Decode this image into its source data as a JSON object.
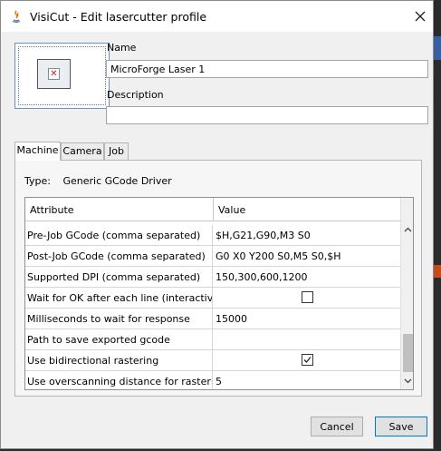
{
  "window": {
    "title": "VisiCut - Edit lasercutter profile",
    "close_icon": "close-icon",
    "app_icon": "java-icon"
  },
  "form": {
    "name_label": "Name",
    "name_value": "MicroForge Laser 1",
    "description_label": "Description",
    "description_value": ""
  },
  "tabs": [
    {
      "label": "Machine",
      "active": true
    },
    {
      "label": "Camera",
      "active": false
    },
    {
      "label": "Job",
      "active": false
    }
  ],
  "machine": {
    "type_label": "Type:",
    "type_value": "Generic GCode Driver",
    "table": {
      "columns": [
        "Attribute",
        "Value"
      ],
      "rows": [
        {
          "attribute": "Pre-Job GCode (comma separated)",
          "value": "$H,G21,G90,M3 S0",
          "kind": "text"
        },
        {
          "attribute": "Post-Job GCode (comma separated)",
          "value": "G0 X0 Y200 S0,M5 S0,$H",
          "kind": "text"
        },
        {
          "attribute": "Supported DPI (comma separated)",
          "value": "150,300,600,1200",
          "kind": "text"
        },
        {
          "attribute": "Wait for OK after each line (interactive ...",
          "value": "",
          "kind": "checkbox",
          "checked": false
        },
        {
          "attribute": "Milliseconds to wait for response",
          "value": "15000",
          "kind": "text"
        },
        {
          "attribute": "Path to save exported gcode",
          "value": "",
          "kind": "text"
        },
        {
          "attribute": "Use bidirectional rastering",
          "value": "",
          "kind": "checkbox",
          "checked": true
        },
        {
          "attribute": "Use overscanning distance for rastering",
          "value": "5",
          "kind": "text"
        }
      ]
    }
  },
  "buttons": {
    "cancel": "Cancel",
    "save": "Save"
  },
  "colors": {
    "accent": "#0078d7",
    "error_icon": "#d42020"
  }
}
